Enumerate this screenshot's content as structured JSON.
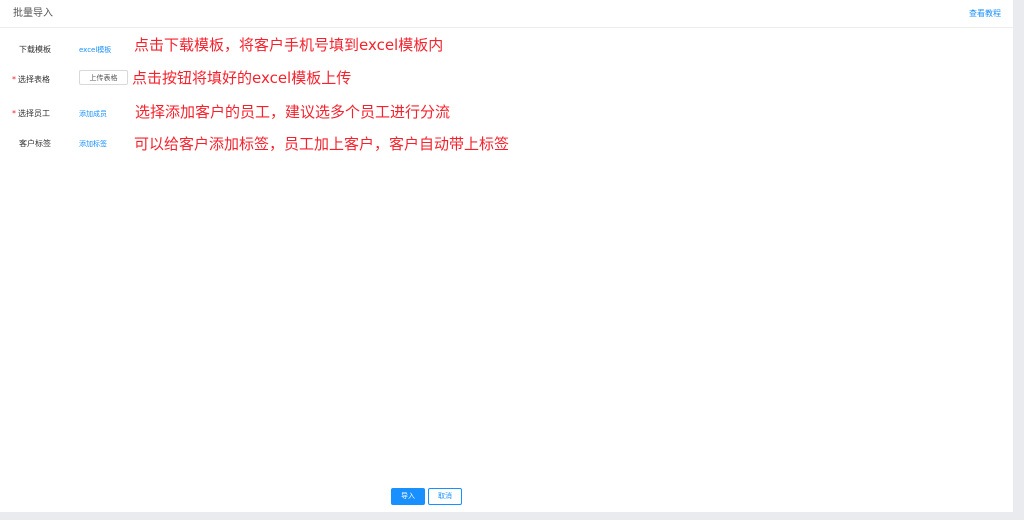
{
  "header": {
    "title": "批量导入",
    "tutorial_link": "查看教程"
  },
  "form": {
    "rows": [
      {
        "label": "下载模板",
        "required": false,
        "action": "excel模板",
        "note": "点击下载模板，将客户手机号填到excel模板内"
      },
      {
        "label": "选择表格",
        "required": true,
        "action": "上传表格",
        "note": "点击按钮将填好的excel模板上传"
      },
      {
        "label": "选择员工",
        "required": true,
        "action": "添加成员",
        "note": "选择添加客户的员工，建议选多个员工进行分流"
      },
      {
        "label": "客户标签",
        "required": false,
        "action": "添加标签",
        "note": "可以给客户添加标签，员工加上客户，客户自动带上标签"
      }
    ],
    "required_mark": "*"
  },
  "footer": {
    "import_label": "导入",
    "cancel_label": "取消"
  },
  "colors": {
    "accent": "#1890ff",
    "annotation": "#f5222d"
  }
}
